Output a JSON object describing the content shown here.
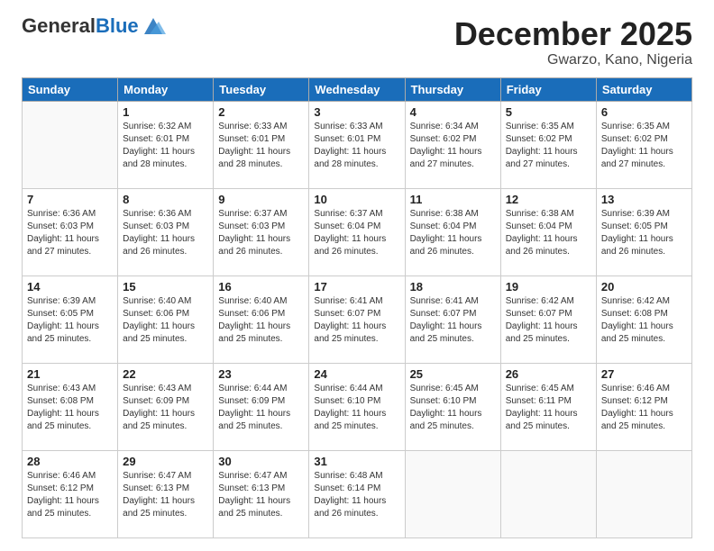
{
  "header": {
    "logo": {
      "general": "General",
      "blue": "Blue"
    },
    "title": "December 2025",
    "location": "Gwarzo, Kano, Nigeria"
  },
  "weekdays": [
    "Sunday",
    "Monday",
    "Tuesday",
    "Wednesday",
    "Thursday",
    "Friday",
    "Saturday"
  ],
  "weeks": [
    [
      {
        "day": "",
        "sunrise": "",
        "sunset": "",
        "daylight": ""
      },
      {
        "day": "1",
        "sunrise": "Sunrise: 6:32 AM",
        "sunset": "Sunset: 6:01 PM",
        "daylight": "Daylight: 11 hours and 28 minutes."
      },
      {
        "day": "2",
        "sunrise": "Sunrise: 6:33 AM",
        "sunset": "Sunset: 6:01 PM",
        "daylight": "Daylight: 11 hours and 28 minutes."
      },
      {
        "day": "3",
        "sunrise": "Sunrise: 6:33 AM",
        "sunset": "Sunset: 6:01 PM",
        "daylight": "Daylight: 11 hours and 28 minutes."
      },
      {
        "day": "4",
        "sunrise": "Sunrise: 6:34 AM",
        "sunset": "Sunset: 6:02 PM",
        "daylight": "Daylight: 11 hours and 27 minutes."
      },
      {
        "day": "5",
        "sunrise": "Sunrise: 6:35 AM",
        "sunset": "Sunset: 6:02 PM",
        "daylight": "Daylight: 11 hours and 27 minutes."
      },
      {
        "day": "6",
        "sunrise": "Sunrise: 6:35 AM",
        "sunset": "Sunset: 6:02 PM",
        "daylight": "Daylight: 11 hours and 27 minutes."
      }
    ],
    [
      {
        "day": "7",
        "sunrise": "Sunrise: 6:36 AM",
        "sunset": "Sunset: 6:03 PM",
        "daylight": "Daylight: 11 hours and 27 minutes."
      },
      {
        "day": "8",
        "sunrise": "Sunrise: 6:36 AM",
        "sunset": "Sunset: 6:03 PM",
        "daylight": "Daylight: 11 hours and 26 minutes."
      },
      {
        "day": "9",
        "sunrise": "Sunrise: 6:37 AM",
        "sunset": "Sunset: 6:03 PM",
        "daylight": "Daylight: 11 hours and 26 minutes."
      },
      {
        "day": "10",
        "sunrise": "Sunrise: 6:37 AM",
        "sunset": "Sunset: 6:04 PM",
        "daylight": "Daylight: 11 hours and 26 minutes."
      },
      {
        "day": "11",
        "sunrise": "Sunrise: 6:38 AM",
        "sunset": "Sunset: 6:04 PM",
        "daylight": "Daylight: 11 hours and 26 minutes."
      },
      {
        "day": "12",
        "sunrise": "Sunrise: 6:38 AM",
        "sunset": "Sunset: 6:04 PM",
        "daylight": "Daylight: 11 hours and 26 minutes."
      },
      {
        "day": "13",
        "sunrise": "Sunrise: 6:39 AM",
        "sunset": "Sunset: 6:05 PM",
        "daylight": "Daylight: 11 hours and 26 minutes."
      }
    ],
    [
      {
        "day": "14",
        "sunrise": "Sunrise: 6:39 AM",
        "sunset": "Sunset: 6:05 PM",
        "daylight": "Daylight: 11 hours and 25 minutes."
      },
      {
        "day": "15",
        "sunrise": "Sunrise: 6:40 AM",
        "sunset": "Sunset: 6:06 PM",
        "daylight": "Daylight: 11 hours and 25 minutes."
      },
      {
        "day": "16",
        "sunrise": "Sunrise: 6:40 AM",
        "sunset": "Sunset: 6:06 PM",
        "daylight": "Daylight: 11 hours and 25 minutes."
      },
      {
        "day": "17",
        "sunrise": "Sunrise: 6:41 AM",
        "sunset": "Sunset: 6:07 PM",
        "daylight": "Daylight: 11 hours and 25 minutes."
      },
      {
        "day": "18",
        "sunrise": "Sunrise: 6:41 AM",
        "sunset": "Sunset: 6:07 PM",
        "daylight": "Daylight: 11 hours and 25 minutes."
      },
      {
        "day": "19",
        "sunrise": "Sunrise: 6:42 AM",
        "sunset": "Sunset: 6:07 PM",
        "daylight": "Daylight: 11 hours and 25 minutes."
      },
      {
        "day": "20",
        "sunrise": "Sunrise: 6:42 AM",
        "sunset": "Sunset: 6:08 PM",
        "daylight": "Daylight: 11 hours and 25 minutes."
      }
    ],
    [
      {
        "day": "21",
        "sunrise": "Sunrise: 6:43 AM",
        "sunset": "Sunset: 6:08 PM",
        "daylight": "Daylight: 11 hours and 25 minutes."
      },
      {
        "day": "22",
        "sunrise": "Sunrise: 6:43 AM",
        "sunset": "Sunset: 6:09 PM",
        "daylight": "Daylight: 11 hours and 25 minutes."
      },
      {
        "day": "23",
        "sunrise": "Sunrise: 6:44 AM",
        "sunset": "Sunset: 6:09 PM",
        "daylight": "Daylight: 11 hours and 25 minutes."
      },
      {
        "day": "24",
        "sunrise": "Sunrise: 6:44 AM",
        "sunset": "Sunset: 6:10 PM",
        "daylight": "Daylight: 11 hours and 25 minutes."
      },
      {
        "day": "25",
        "sunrise": "Sunrise: 6:45 AM",
        "sunset": "Sunset: 6:10 PM",
        "daylight": "Daylight: 11 hours and 25 minutes."
      },
      {
        "day": "26",
        "sunrise": "Sunrise: 6:45 AM",
        "sunset": "Sunset: 6:11 PM",
        "daylight": "Daylight: 11 hours and 25 minutes."
      },
      {
        "day": "27",
        "sunrise": "Sunrise: 6:46 AM",
        "sunset": "Sunset: 6:12 PM",
        "daylight": "Daylight: 11 hours and 25 minutes."
      }
    ],
    [
      {
        "day": "28",
        "sunrise": "Sunrise: 6:46 AM",
        "sunset": "Sunset: 6:12 PM",
        "daylight": "Daylight: 11 hours and 25 minutes."
      },
      {
        "day": "29",
        "sunrise": "Sunrise: 6:47 AM",
        "sunset": "Sunset: 6:13 PM",
        "daylight": "Daylight: 11 hours and 25 minutes."
      },
      {
        "day": "30",
        "sunrise": "Sunrise: 6:47 AM",
        "sunset": "Sunset: 6:13 PM",
        "daylight": "Daylight: 11 hours and 25 minutes."
      },
      {
        "day": "31",
        "sunrise": "Sunrise: 6:48 AM",
        "sunset": "Sunset: 6:14 PM",
        "daylight": "Daylight: 11 hours and 26 minutes."
      },
      {
        "day": "",
        "sunrise": "",
        "sunset": "",
        "daylight": ""
      },
      {
        "day": "",
        "sunrise": "",
        "sunset": "",
        "daylight": ""
      },
      {
        "day": "",
        "sunrise": "",
        "sunset": "",
        "daylight": ""
      }
    ]
  ]
}
